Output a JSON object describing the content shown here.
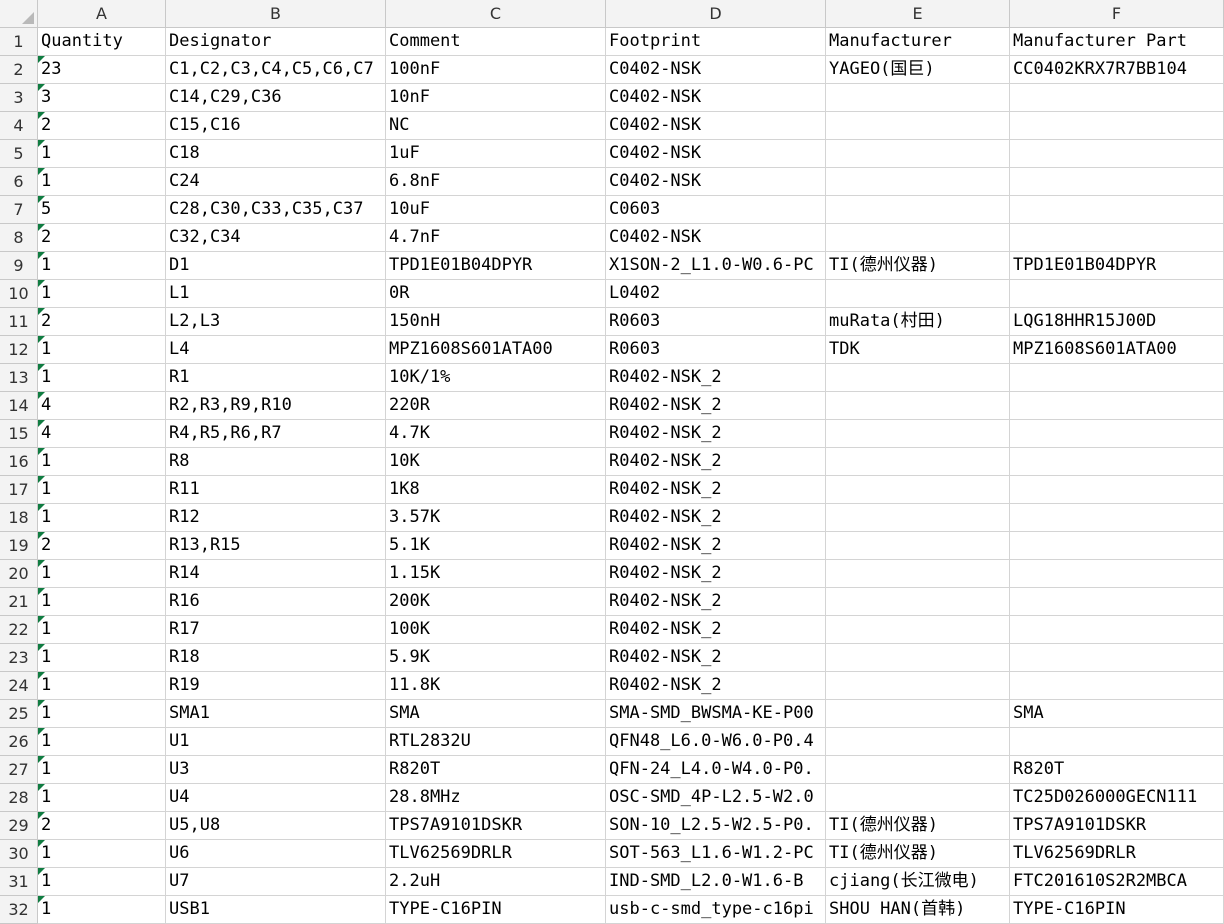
{
  "columns": [
    "A",
    "B",
    "C",
    "D",
    "E",
    "F"
  ],
  "rows": [
    {
      "row": "1",
      "cells": [
        "Quantity",
        "Designator",
        "Comment",
        "Footprint",
        "Manufacturer",
        "Manufacturer Part"
      ]
    },
    {
      "row": "2",
      "cells": [
        "23",
        "C1,C2,C3,C4,C5,C6,C7",
        "100nF",
        "C0402-NSK",
        "YAGEO(国巨)",
        "CC0402KRX7R7BB104"
      ]
    },
    {
      "row": "3",
      "cells": [
        "3",
        "C14,C29,C36",
        "10nF",
        "C0402-NSK",
        "",
        ""
      ]
    },
    {
      "row": "4",
      "cells": [
        "2",
        "C15,C16",
        "NC",
        "C0402-NSK",
        "",
        ""
      ]
    },
    {
      "row": "5",
      "cells": [
        "1",
        "C18",
        "1uF",
        "C0402-NSK",
        "",
        ""
      ]
    },
    {
      "row": "6",
      "cells": [
        "1",
        "C24",
        "6.8nF",
        "C0402-NSK",
        "",
        ""
      ]
    },
    {
      "row": "7",
      "cells": [
        "5",
        "C28,C30,C33,C35,C37",
        "10uF",
        "C0603",
        "",
        ""
      ]
    },
    {
      "row": "8",
      "cells": [
        "2",
        "C32,C34",
        "4.7nF",
        "C0402-NSK",
        "",
        ""
      ]
    },
    {
      "row": "9",
      "cells": [
        "1",
        "D1",
        "TPD1E01B04DPYR",
        "X1SON-2_L1.0-W0.6-PC",
        "TI(德州仪器)",
        "TPD1E01B04DPYR"
      ]
    },
    {
      "row": "10",
      "cells": [
        "1",
        "L1",
        "0R",
        "L0402",
        "",
        ""
      ]
    },
    {
      "row": "11",
      "cells": [
        "2",
        "L2,L3",
        "150nH",
        "R0603",
        "muRata(村田)",
        "LQG18HHR15J00D"
      ]
    },
    {
      "row": "12",
      "cells": [
        "1",
        "L4",
        "MPZ1608S601ATA00",
        "R0603",
        "TDK",
        "MPZ1608S601ATA00"
      ]
    },
    {
      "row": "13",
      "cells": [
        "1",
        "R1",
        "10K/1%",
        "R0402-NSK_2",
        "",
        ""
      ]
    },
    {
      "row": "14",
      "cells": [
        "4",
        "R2,R3,R9,R10",
        "220R",
        "R0402-NSK_2",
        "",
        ""
      ]
    },
    {
      "row": "15",
      "cells": [
        "4",
        "R4,R5,R6,R7",
        "4.7K",
        "R0402-NSK_2",
        "",
        ""
      ]
    },
    {
      "row": "16",
      "cells": [
        "1",
        "R8",
        "10K",
        "R0402-NSK_2",
        "",
        ""
      ]
    },
    {
      "row": "17",
      "cells": [
        "1",
        "R11",
        "1K8",
        "R0402-NSK_2",
        "",
        ""
      ]
    },
    {
      "row": "18",
      "cells": [
        "1",
        "R12",
        "3.57K",
        "R0402-NSK_2",
        "",
        ""
      ]
    },
    {
      "row": "19",
      "cells": [
        "2",
        "R13,R15",
        "5.1K",
        "R0402-NSK_2",
        "",
        ""
      ]
    },
    {
      "row": "20",
      "cells": [
        "1",
        "R14",
        "1.15K",
        "R0402-NSK_2",
        "",
        ""
      ]
    },
    {
      "row": "21",
      "cells": [
        "1",
        "R16",
        "200K",
        "R0402-NSK_2",
        "",
        ""
      ]
    },
    {
      "row": "22",
      "cells": [
        "1",
        "R17",
        "100K",
        "R0402-NSK_2",
        "",
        ""
      ]
    },
    {
      "row": "23",
      "cells": [
        "1",
        "R18",
        "5.9K",
        "R0402-NSK_2",
        "",
        ""
      ]
    },
    {
      "row": "24",
      "cells": [
        "1",
        "R19",
        "11.8K",
        "R0402-NSK_2",
        "",
        ""
      ]
    },
    {
      "row": "25",
      "cells": [
        "1",
        "SMA1",
        "SMA",
        "SMA-SMD_BWSMA-KE-P00",
        "",
        "SMA"
      ]
    },
    {
      "row": "26",
      "cells": [
        "1",
        "U1",
        "RTL2832U",
        "QFN48_L6.0-W6.0-P0.4",
        "",
        ""
      ]
    },
    {
      "row": "27",
      "cells": [
        "1",
        "U3",
        "R820T",
        "QFN-24_L4.0-W4.0-P0.",
        "",
        "R820T"
      ]
    },
    {
      "row": "28",
      "cells": [
        "1",
        "U4",
        "28.8MHz",
        "OSC-SMD_4P-L2.5-W2.0",
        "",
        "TC25D026000GECN111"
      ]
    },
    {
      "row": "29",
      "cells": [
        "2",
        "U5,U8",
        "TPS7A9101DSKR",
        "SON-10_L2.5-W2.5-P0.",
        "TI(德州仪器)",
        "TPS7A9101DSKR"
      ]
    },
    {
      "row": "30",
      "cells": [
        "1",
        "U6",
        "TLV62569DRLR",
        "SOT-563_L1.6-W1.2-PC",
        "TI(德州仪器)",
        "TLV62569DRLR"
      ]
    },
    {
      "row": "31",
      "cells": [
        "1",
        "U7",
        "2.2uH",
        "IND-SMD_L2.0-W1.6-B",
        "cjiang(长江微电)",
        "FTC201610S2R2MBCA"
      ]
    },
    {
      "row": "32",
      "cells": [
        "1",
        "USB1",
        "TYPE-C16PIN",
        "usb-c-smd_type-c16pi",
        "SHOU HAN(首韩)",
        "TYPE-C16PIN"
      ]
    }
  ],
  "colors": {
    "header_bg": "#f3f3f3",
    "gridline": "#d4d4d4",
    "error_flag": "#107c41"
  }
}
